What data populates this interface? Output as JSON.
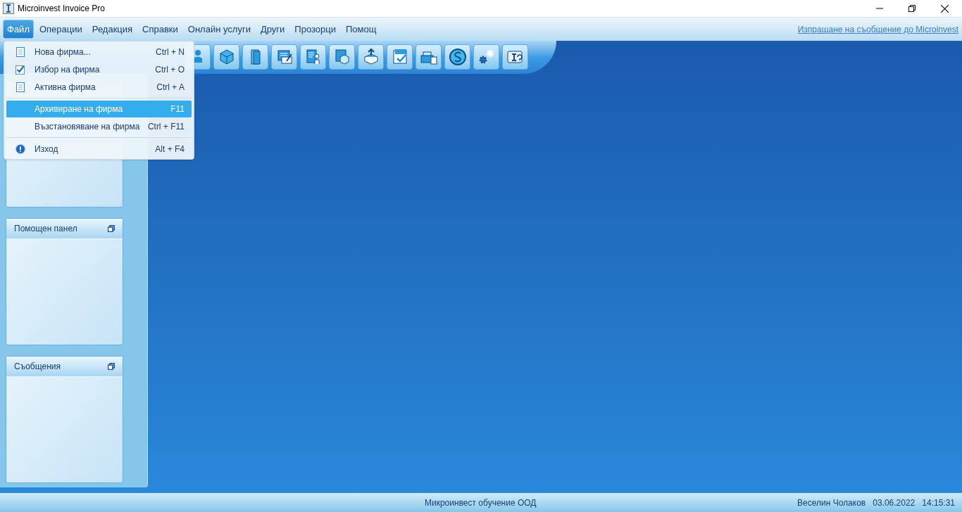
{
  "window": {
    "title": "Microinvest Invoice Pro"
  },
  "menu_bar": [
    {
      "label": "Файл",
      "selected": true
    },
    {
      "label": "Операции",
      "selected": false
    },
    {
      "label": "Редакция",
      "selected": false
    },
    {
      "label": "Справки",
      "selected": false
    },
    {
      "label": "Онлайн услуги",
      "selected": false
    },
    {
      "label": "Други",
      "selected": false
    },
    {
      "label": "Прозорци",
      "selected": false
    },
    {
      "label": "Помощ",
      "selected": false
    }
  ],
  "feedback_link": "Изпращане на съобщение до Microinvest",
  "file_menu": {
    "groups": [
      [
        {
          "label": "Нова фирма...",
          "shortcut": "Ctrl + N",
          "kind": "document",
          "selected": false
        },
        {
          "label": "Избор на фирма",
          "shortcut": "Ctrl + O",
          "kind": "check",
          "selected": false
        },
        {
          "label": "Активна фирма",
          "shortcut": "Ctrl + A",
          "kind": "document",
          "selected": false
        }
      ],
      [
        {
          "label": "Архивиране на фирма",
          "shortcut": "F11",
          "kind": "plain",
          "selected": true
        },
        {
          "label": "Възстановяване на фирма",
          "shortcut": "Ctrl + F11",
          "kind": "plain",
          "selected": false
        }
      ],
      [
        {
          "label": "Изход",
          "shortcut": "Alt + F4",
          "kind": "info",
          "selected": false
        }
      ]
    ]
  },
  "side_panels": [
    {
      "kind": "covered"
    },
    {
      "kind": "titled",
      "title": "Помощен панел"
    },
    {
      "kind": "titled",
      "title": "Съобщения"
    }
  ],
  "status_bar": {
    "company": "Микроинвест обучение ООД",
    "user": "Веселин Чолаков",
    "date": "03.06.2022",
    "time": "14:15:31"
  }
}
